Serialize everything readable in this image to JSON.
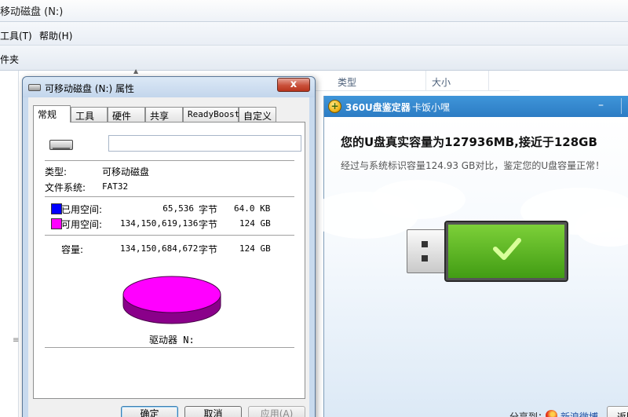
{
  "explorer": {
    "title": "移动磁盘 (N:)",
    "menu": {
      "tools": "工具(T)",
      "help": "帮助(H)"
    },
    "toolbar_label": "件夹",
    "columns": {
      "type": "类型",
      "size": "大小"
    }
  },
  "dialog": {
    "title": "可移动磁盘 (N:) 属性",
    "close_glyph": "x",
    "tabs": [
      "常规",
      "工具",
      "硬件",
      "共享",
      "ReadyBoost",
      "自定义"
    ],
    "name_value": "",
    "type_label": "类型:",
    "type_value": "可移动磁盘",
    "fs_label": "文件系统:",
    "fs_value": "FAT32",
    "used": {
      "label": "已用空间:",
      "bytes": "65,536",
      "unit": "字节",
      "human": "64.0 KB",
      "color": "#0000ff"
    },
    "free": {
      "label": "可用空间:",
      "bytes": "134,150,619,136",
      "unit": "字节",
      "human": "124 GB",
      "color": "#ff00ff"
    },
    "capacity": {
      "label": "容量:",
      "bytes": "134,150,684,672",
      "unit": "字节",
      "human": "124 GB"
    },
    "drive_label": "驱动器 N:",
    "buttons": {
      "ok": "确定",
      "cancel": "取消",
      "apply": "应用(A)"
    }
  },
  "checker": {
    "title": "360U盘鉴定器",
    "subtitle": "卡饭小嘿",
    "min_glyph": "–",
    "headline": "您的U盘真实容量为127936MB,接近于128GB",
    "description": "经过与系统标识容量124.93 GB对比，鉴定您的U盘容量正常！",
    "share_label": "分享到：",
    "weibo_label": "新浪微博",
    "back_label": "返回",
    "accent_color": "#2c7cc4",
    "status_color": "#4caf1f"
  }
}
